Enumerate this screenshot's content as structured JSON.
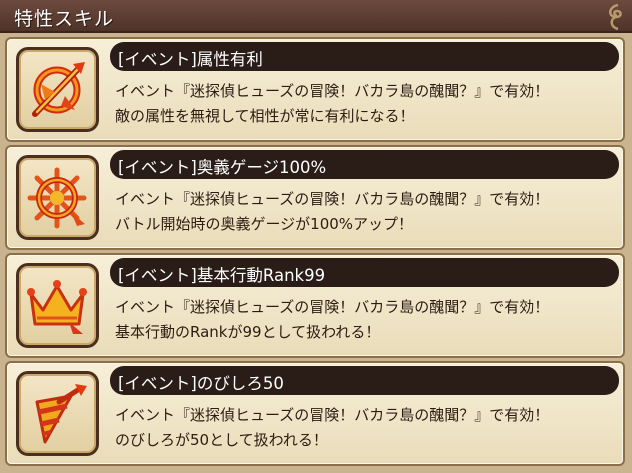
{
  "header": {
    "title": "特性スキル"
  },
  "skills": [
    {
      "title": "[イベント]属性有利",
      "icon": "attribute-advantage-icon",
      "line1": "イベント『迷探偵ヒューズの冒険！バカラ島の醜聞？』で有効！",
      "line2": "敵の属性を無視して相性が常に有利になる！"
    },
    {
      "title": "[イベント]奥義ゲージ100%",
      "icon": "ougi-gauge-icon",
      "line1": "イベント『迷探偵ヒューズの冒険！バカラ島の醜聞？』で有効！",
      "line2": "バトル開始時の奥義ゲージが100%アップ！"
    },
    {
      "title": "[イベント]基本行動Rank99",
      "icon": "crown-icon",
      "line1": "イベント『迷探偵ヒューズの冒険！バカラ島の醜聞？』で有効！",
      "line2": "基本行動のRankが99として扱われる！"
    },
    {
      "title": "[イベント]のびしろ50",
      "icon": "drill-icon",
      "line1": "イベント『迷探偵ヒューズの冒険！バカラ島の醜聞？』で有効！",
      "line2": "のびしろが50として扱われる！"
    }
  ]
}
